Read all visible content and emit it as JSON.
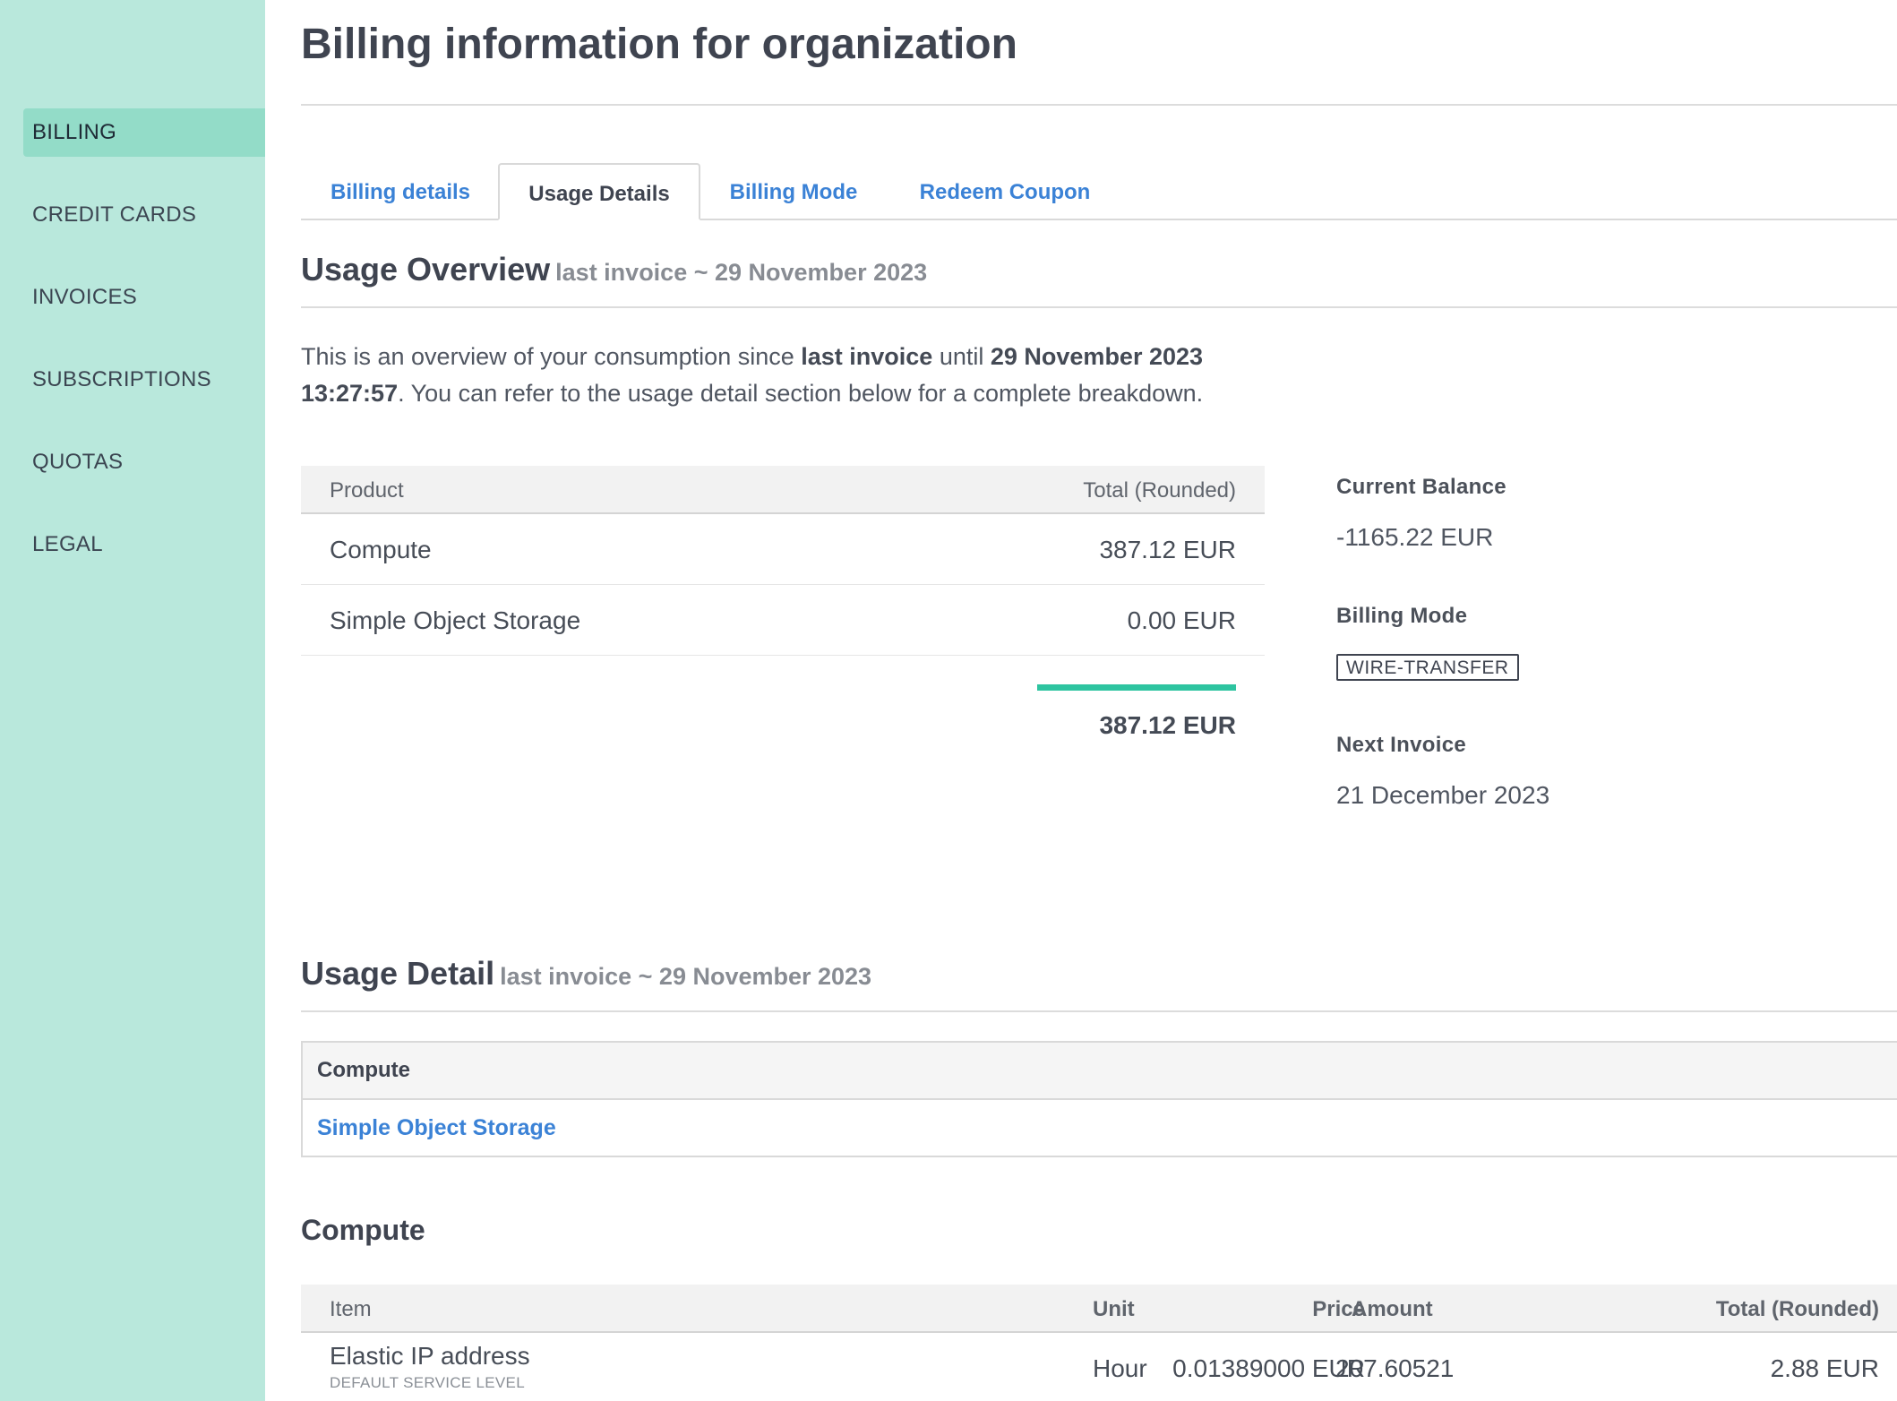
{
  "sidebar": {
    "items": [
      {
        "label": "BILLING",
        "active": true
      },
      {
        "label": "CREDIT CARDS"
      },
      {
        "label": "INVOICES"
      },
      {
        "label": "SUBSCRIPTIONS"
      },
      {
        "label": "QUOTAS"
      },
      {
        "label": "LEGAL"
      }
    ]
  },
  "page": {
    "title": "Billing information for organization"
  },
  "tabs": [
    {
      "label": "Billing details"
    },
    {
      "label": "Usage Details",
      "active": true
    },
    {
      "label": "Billing Mode"
    },
    {
      "label": "Redeem Coupon"
    }
  ],
  "overview": {
    "title": "Usage Overview",
    "subtitle": "last invoice ~ 29 November 2023",
    "para": {
      "t1": "This is an overview of your consumption since ",
      "b1": "last invoice",
      "t2": " until ",
      "b2": "29 November 2023 13:27:57",
      "t3": ". You can refer to the usage detail section below for a complete breakdown."
    },
    "table": {
      "col_product": "Product",
      "col_total": "Total (Rounded)",
      "rows": [
        {
          "product": "Compute",
          "total": "387.12 EUR"
        },
        {
          "product": "Simple Object Storage",
          "total": "0.00 EUR"
        }
      ],
      "grand_total": "387.12 EUR"
    },
    "current_balance": {
      "label": "Current Balance",
      "value": "-1165.22 EUR"
    },
    "billing_mode": {
      "label": "Billing Mode",
      "value": "WIRE-TRANSFER"
    },
    "next_invoice": {
      "label": "Next Invoice",
      "value": "21 December 2023"
    }
  },
  "detail": {
    "title": "Usage Detail",
    "subtitle": "last invoice ~ 29 November 2023",
    "nav": {
      "active": "Compute",
      "link": "Simple Object Storage"
    },
    "compute": {
      "title": "Compute",
      "columns": {
        "item": "Item",
        "price": "Price",
        "unit": "Unit",
        "amount": "Amount",
        "total": "Total (Rounded)"
      },
      "rows": [
        {
          "item": "Elastic IP address",
          "level": "DEFAULT SERVICE LEVEL",
          "price": "0.01389000 EUR",
          "unit": "Hour",
          "amount": "207.60521",
          "total": "2.88 EUR"
        }
      ]
    }
  },
  "colors": {
    "sidebar": "#b9e8dc",
    "sidebar_active": "#93dcc8",
    "link": "#3b82d6",
    "accent": "#2ec4a0"
  }
}
